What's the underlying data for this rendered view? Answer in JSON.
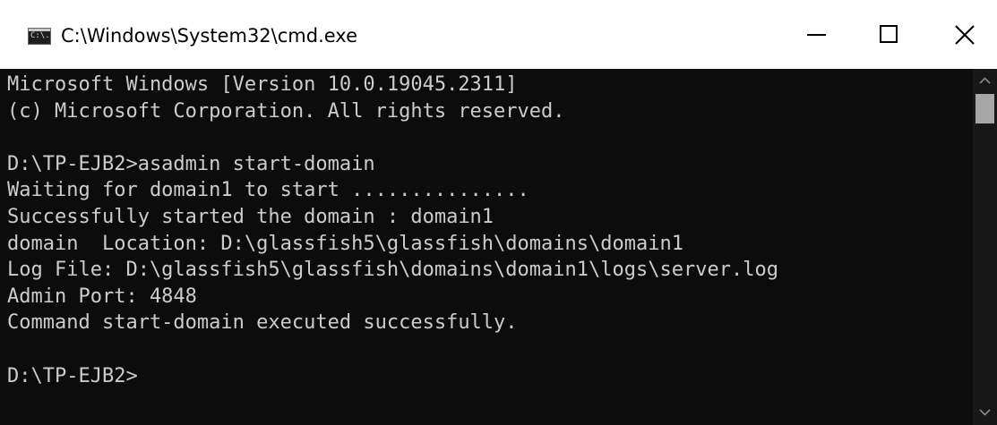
{
  "window": {
    "title": "C:\\Windows\\System32\\cmd.exe",
    "app_icon_text": "C:\\."
  },
  "console": {
    "lines": [
      "Microsoft Windows [Version 10.0.19045.2311]",
      "(c) Microsoft Corporation. All rights reserved.",
      "",
      "D:\\TP-EJB2>asadmin start-domain",
      "Waiting for domain1 to start ...............",
      "Successfully started the domain : domain1",
      "domain  Location: D:\\glassfish5\\glassfish\\domains\\domain1",
      "Log File: D:\\glassfish5\\glassfish\\domains\\domain1\\logs\\server.log",
      "Admin Port: 4848",
      "Command start-domain executed successfully.",
      "",
      "D:\\TP-EJB2>"
    ]
  },
  "icons": {
    "app": "cmd-app-icon",
    "minimize": "minimize-icon",
    "maximize": "maximize-icon",
    "close": "close-icon",
    "scroll_up": "chevron-up-icon",
    "scroll_down": "chevron-down-icon"
  },
  "colors": {
    "titlebar_bg": "#ffffff",
    "console_bg": "#0c0c0c",
    "console_text": "#cccccc",
    "scrollbar_track": "#171717",
    "scrollbar_thumb": "#a6a6a6"
  }
}
